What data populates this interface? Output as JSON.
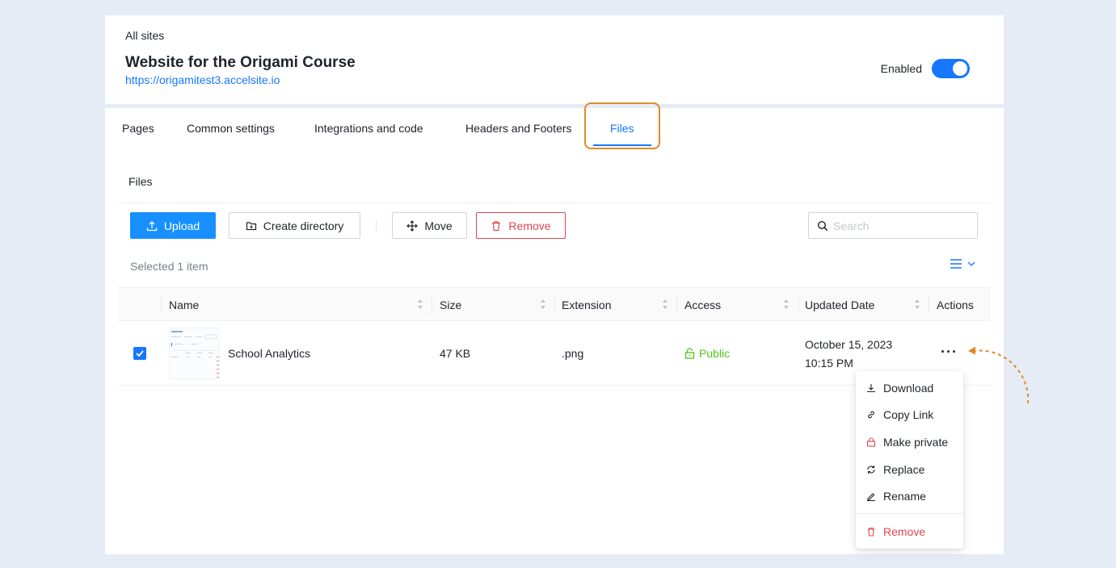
{
  "header": {
    "breadcrumb": "All sites",
    "site_title": "Website for the Origami Course",
    "site_url": "https://origamitest3.accelsite.io",
    "enabled_label": "Enabled",
    "enabled": true
  },
  "tabs": [
    {
      "label": "Pages",
      "active": false
    },
    {
      "label": "Common settings",
      "active": false
    },
    {
      "label": "Integrations and code",
      "active": false
    },
    {
      "label": "Headers and Footers",
      "active": false
    },
    {
      "label": "Files",
      "active": true
    }
  ],
  "files": {
    "section_title": "Files",
    "toolbar": {
      "upload_label": "Upload",
      "create_directory_label": "Create directory",
      "move_label": "Move",
      "remove_label": "Remove"
    },
    "search": {
      "placeholder": "Search",
      "value": ""
    },
    "selected_text": "Selected 1 item",
    "columns": {
      "name": "Name",
      "size": "Size",
      "extension": "Extension",
      "access": "Access",
      "updated": "Updated Date",
      "actions": "Actions"
    },
    "rows": [
      {
        "checked": true,
        "name": "School Analytics",
        "size": "47 KB",
        "extension": ".png",
        "access": "Public",
        "updated_date": "October 15, 2023",
        "updated_time": "10:15 PM",
        "actions_icon": "more-dots-icon"
      }
    ],
    "context_menu": [
      {
        "label": "Download",
        "icon": "download-icon"
      },
      {
        "label": "Copy Link",
        "icon": "link-icon"
      },
      {
        "label": "Make private",
        "icon": "lock-icon"
      },
      {
        "label": "Replace",
        "icon": "refresh-icon"
      },
      {
        "label": "Rename",
        "icon": "pencil-icon"
      },
      {
        "label": "Remove",
        "icon": "trash-icon"
      }
    ]
  },
  "colors": {
    "primary": "#1677ff",
    "danger": "#e0454f",
    "success": "#52c41a",
    "highlight": "#e08a2a",
    "background": "#e6ecf5"
  }
}
